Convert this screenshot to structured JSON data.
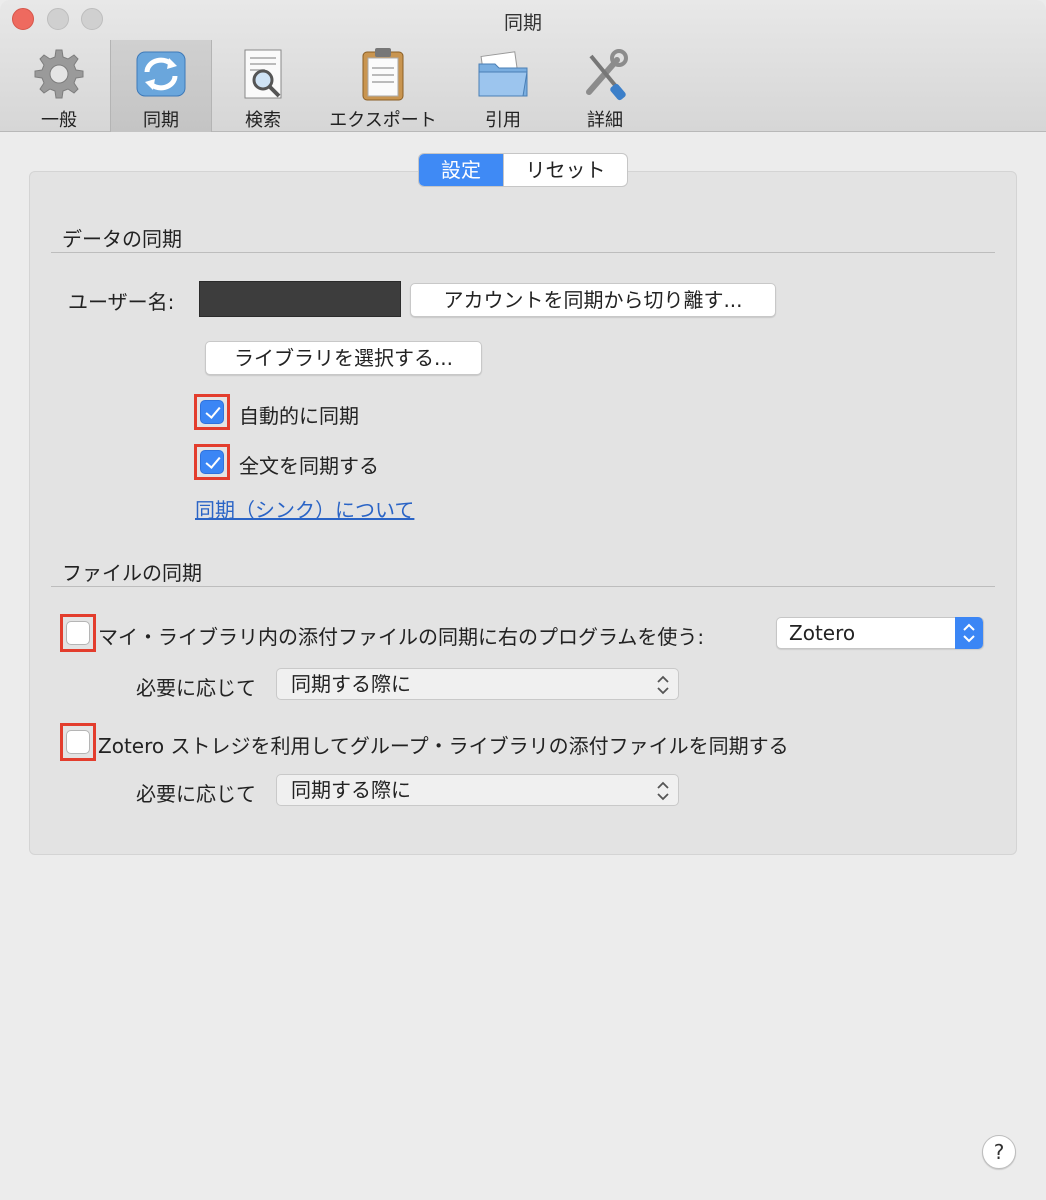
{
  "window": {
    "title": "同期"
  },
  "toolbar": {
    "items": [
      {
        "label": "一般",
        "icon": "gear-icon"
      },
      {
        "label": "同期",
        "icon": "sync-icon",
        "active": true
      },
      {
        "label": "検索",
        "icon": "search-document-icon"
      },
      {
        "label": "エクスポート",
        "icon": "clipboard-icon"
      },
      {
        "label": "引用",
        "icon": "folder-icon"
      },
      {
        "label": "詳細",
        "icon": "tools-icon"
      }
    ]
  },
  "tabs": {
    "settings": "設定",
    "reset": "リセット"
  },
  "data_sync": {
    "title": "データの同期",
    "username_label": "ユーザー名:",
    "unlink_button": "アカウントを同期から切り離す...",
    "choose_libraries_button": "ライブラリを選択する...",
    "auto_sync": {
      "label": "自動的に同期",
      "checked": true
    },
    "fulltext_sync": {
      "label": "全文を同期する",
      "checked": true
    },
    "about_link": "同期（シンク）について"
  },
  "file_sync": {
    "title": "ファイルの同期",
    "my_library": {
      "label": "マイ・ライブラリ内の添付ファイルの同期に右のプログラムを使う:",
      "checked": false,
      "program": "Zotero",
      "download_label": "必要に応じて",
      "download_value": "同期する際に"
    },
    "group": {
      "label": "Zotero ストレジを利用してグループ・ライブラリの添付ファイルを同期する",
      "checked": false,
      "download_label": "必要に応じて",
      "download_value": "同期する際に"
    }
  },
  "help": {
    "label": "?"
  },
  "colors": {
    "accent": "#3b86f5",
    "highlight": "#e33d2d",
    "link": "#2a64c6"
  }
}
